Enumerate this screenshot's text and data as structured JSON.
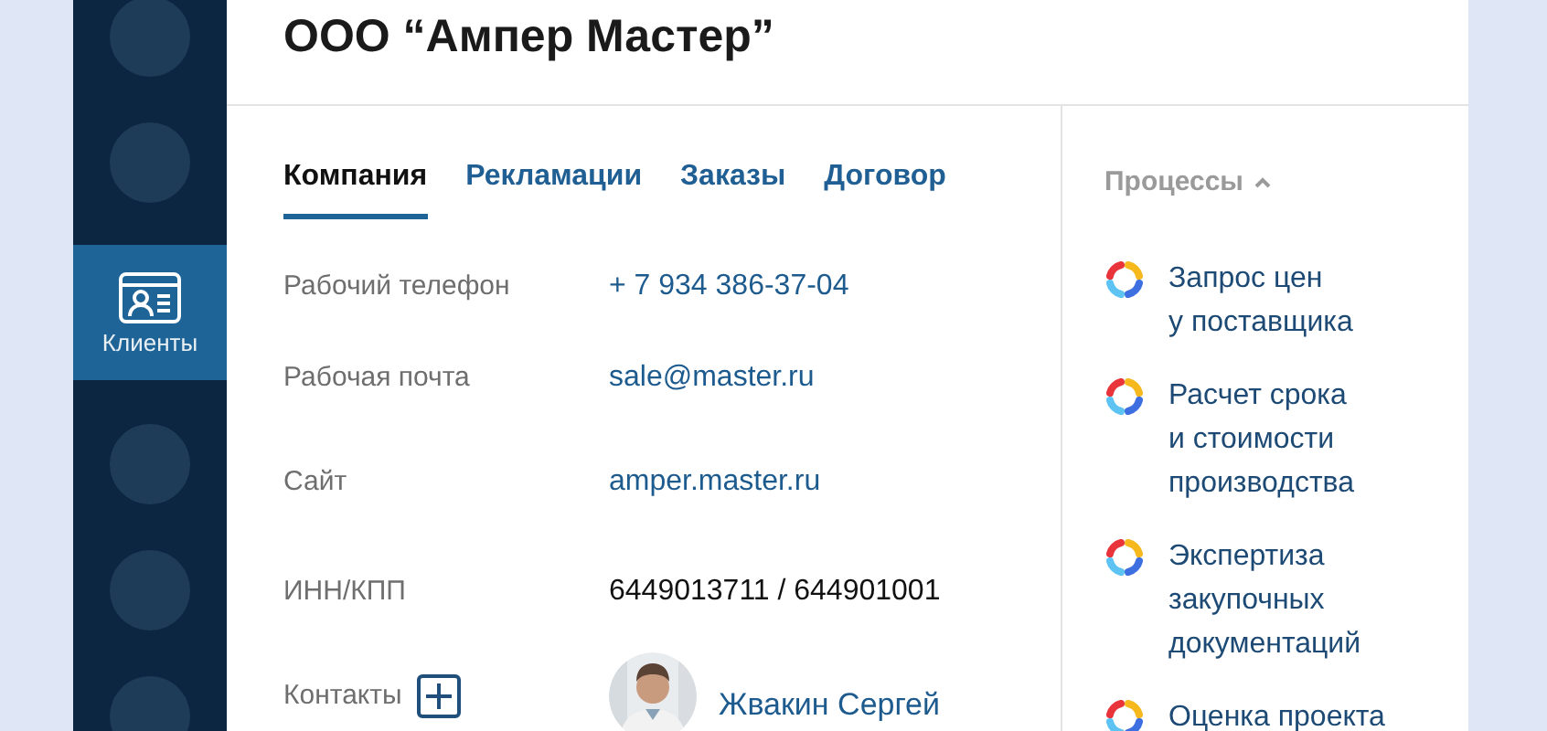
{
  "sidebar": {
    "items": [
      {
        "kind": "placeholder"
      },
      {
        "kind": "placeholder"
      },
      {
        "kind": "nav",
        "label": "Клиенты",
        "selected": true
      },
      {
        "kind": "placeholder"
      },
      {
        "kind": "placeholder"
      },
      {
        "kind": "placeholder"
      }
    ]
  },
  "header": {
    "title": "ООО “Ампер Мастер”"
  },
  "tabs": [
    {
      "label": "Компания",
      "selected": true
    },
    {
      "label": "Рекламации",
      "selected": false
    },
    {
      "label": "Заказы",
      "selected": false
    },
    {
      "label": "Договор",
      "selected": false
    }
  ],
  "fields": [
    {
      "kind": "link",
      "label": "Рабочий телефон",
      "value": "+ 7 934 386-37-04"
    },
    {
      "kind": "link",
      "label": "Рабочая почта",
      "value": "sale@master.ru"
    },
    {
      "kind": "link",
      "label": "Сайт",
      "value": "amper.master.ru"
    },
    {
      "kind": "text",
      "label": "ИНН/КПП",
      "value": "6449013711 /  644901001"
    },
    {
      "kind": "contacts",
      "label": "Контакты",
      "contact": {
        "name": "Жвакин Сергей"
      }
    }
  ],
  "processes": {
    "title": "Процессы",
    "expanded": true,
    "items": [
      {
        "label": "Запрос цен\nу поставщика"
      },
      {
        "label": "Расчет срока\nи стоимости\nпроизводства"
      },
      {
        "label": "Экспертиза\nзакупочных\nдокументаций"
      },
      {
        "label": "Оценка проекта"
      }
    ]
  }
}
